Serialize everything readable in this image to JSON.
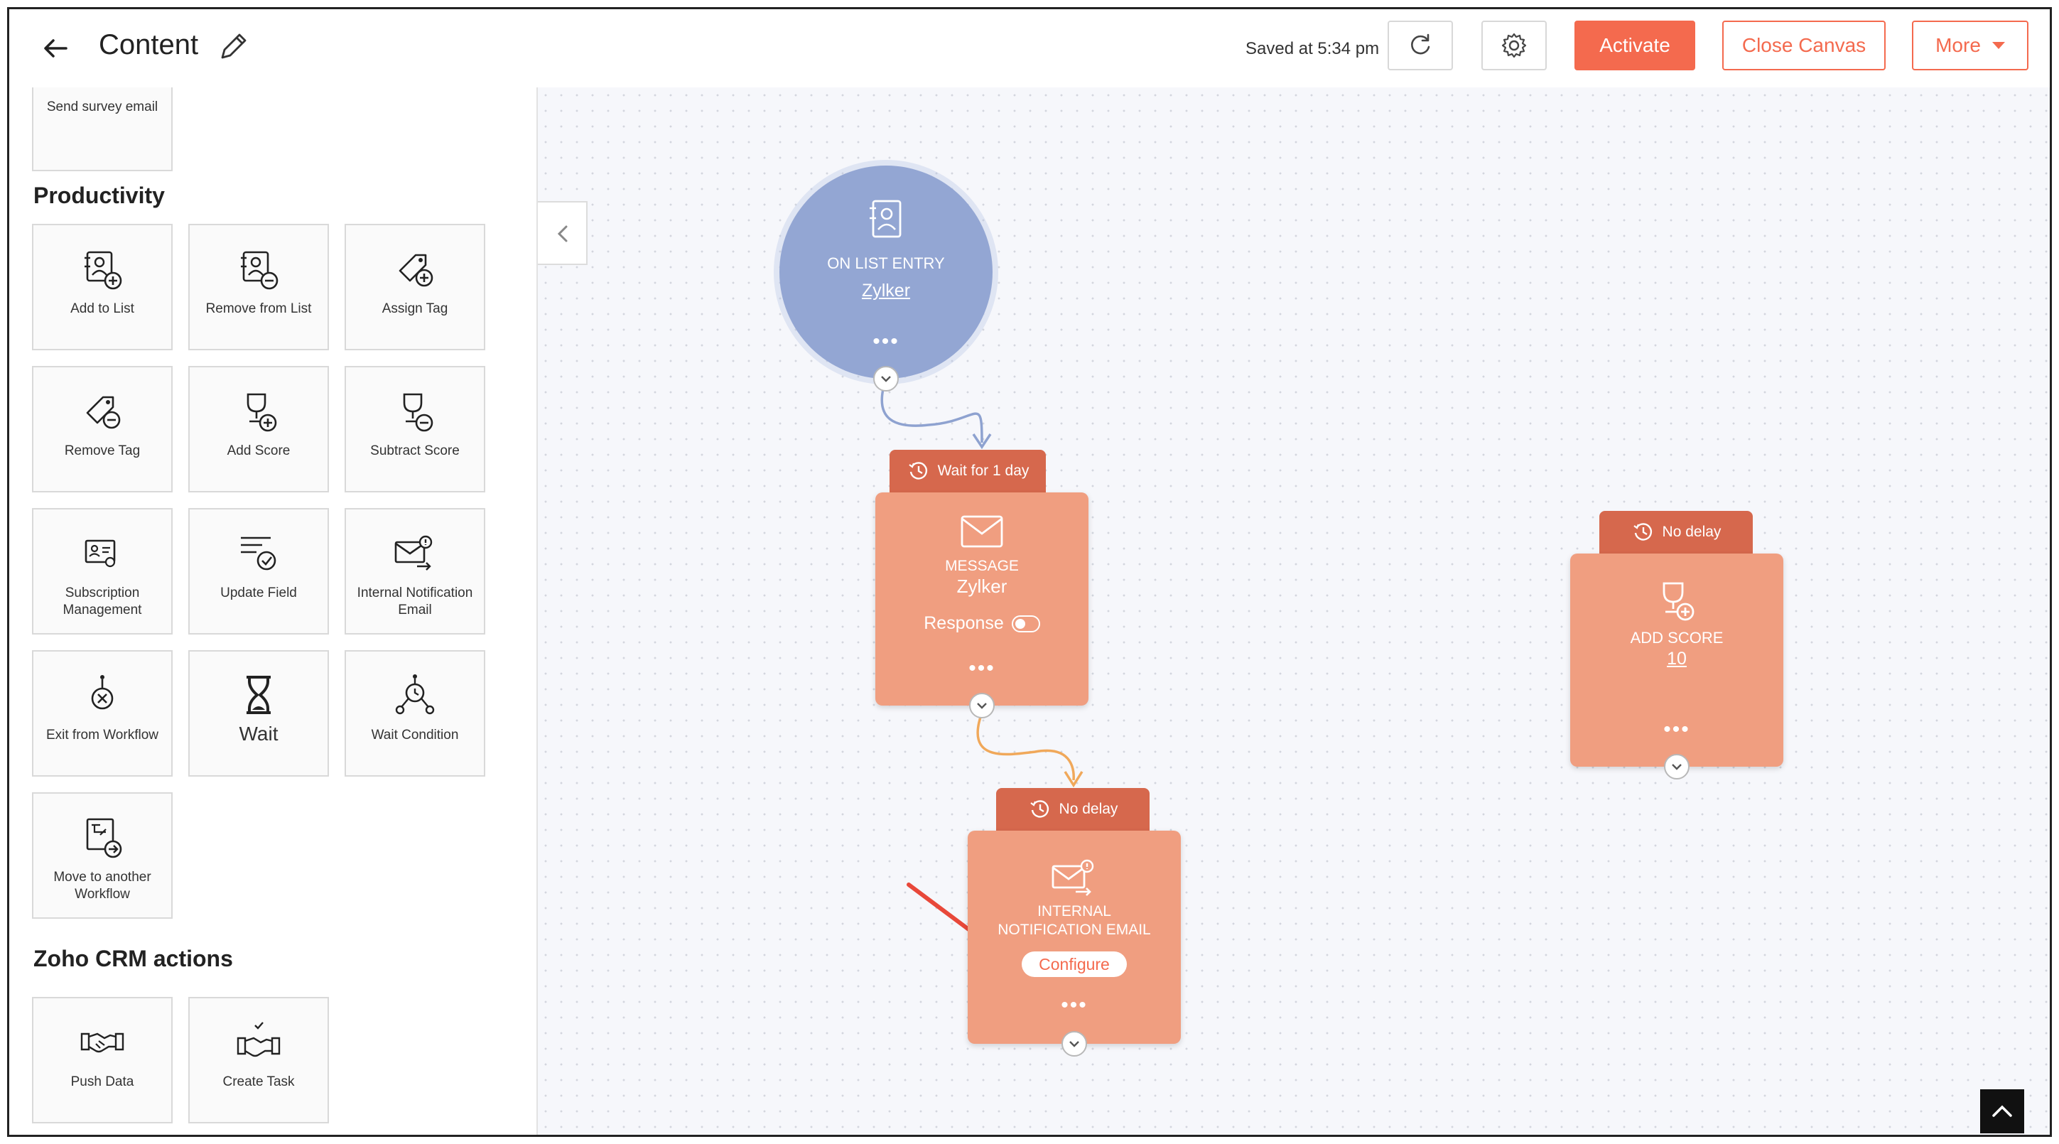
{
  "header": {
    "title": "Content",
    "saved_text": "Saved at 5:34 pm",
    "activate_label": "Activate",
    "close_canvas_label": "Close Canvas",
    "more_label": "More"
  },
  "sidebar": {
    "top_item": "Send survey email",
    "productivity_heading": "Productivity",
    "productivity_items": [
      {
        "label": "Add to List",
        "icon": "add-to-list-icon"
      },
      {
        "label": "Remove from List",
        "icon": "remove-from-list-icon"
      },
      {
        "label": "Assign Tag",
        "icon": "assign-tag-icon"
      },
      {
        "label": "Remove Tag",
        "icon": "remove-tag-icon"
      },
      {
        "label": "Add Score",
        "icon": "add-score-icon"
      },
      {
        "label": "Subtract Score",
        "icon": "subtract-score-icon"
      },
      {
        "label": "Subscription Management",
        "icon": "subscription-icon"
      },
      {
        "label": "Update Field",
        "icon": "update-field-icon"
      },
      {
        "label": "Internal Notification Email",
        "icon": "notification-email-icon"
      },
      {
        "label": "Exit from Workflow",
        "icon": "exit-workflow-icon"
      },
      {
        "label": "Wait",
        "icon": "hourglass-icon"
      },
      {
        "label": "Wait Condition",
        "icon": "wait-condition-icon"
      },
      {
        "label": "Move to another Workflow",
        "icon": "move-workflow-icon"
      }
    ],
    "crm_heading": "Zoho CRM actions",
    "crm_items": [
      {
        "label": "Push Data",
        "icon": "handshake-icon"
      },
      {
        "label": "Create Task",
        "icon": "create-task-icon"
      }
    ]
  },
  "canvas": {
    "entry_node": {
      "title": "ON LIST ENTRY",
      "link": "Zylker",
      "dots": "•••"
    },
    "message_node": {
      "tab": "Wait for 1 day",
      "type": "MESSAGE",
      "name": "Zylker",
      "response_label": "Response",
      "dots": "•••"
    },
    "notification_node": {
      "tab": "No delay",
      "type_line1": "INTERNAL",
      "type_line2": "NOTIFICATION EMAIL",
      "configure_label": "Configure",
      "dots": "•••"
    },
    "score_node": {
      "tab": "No delay",
      "type": "ADD SCORE",
      "value": "10",
      "dots": "•••"
    }
  },
  "colors": {
    "accent": "#f46a4e",
    "node_fill": "#f09e80",
    "node_tab": "#d6684d",
    "entry_fill": "#93a6d3",
    "connector_blue": "#8ea2d0",
    "connector_orange": "#f0a85a",
    "arrow_red": "#e8483a"
  }
}
